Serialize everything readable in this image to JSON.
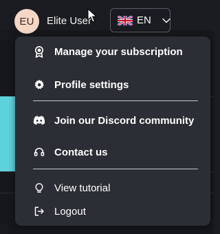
{
  "user": {
    "initials": "EU",
    "name": "Elite User"
  },
  "language": {
    "code": "EN",
    "flag": "uk-flag-icon"
  },
  "menu": {
    "items": [
      {
        "label": "Manage your subscription",
        "icon": "award-badge-icon"
      },
      {
        "label": "Profile settings",
        "icon": "gear-icon"
      },
      {
        "label": "Join our Discord community",
        "icon": "discord-icon"
      },
      {
        "label": "Contact us",
        "icon": "headset-icon"
      },
      {
        "label": "View tutorial",
        "icon": "lightbulb-icon"
      },
      {
        "label": "Logout",
        "icon": "logout-icon"
      }
    ]
  },
  "colors": {
    "menu_bg": "#2c2e35",
    "avatar_bg": "#f6d6c4",
    "accent_strip": "#5fd3dd"
  }
}
